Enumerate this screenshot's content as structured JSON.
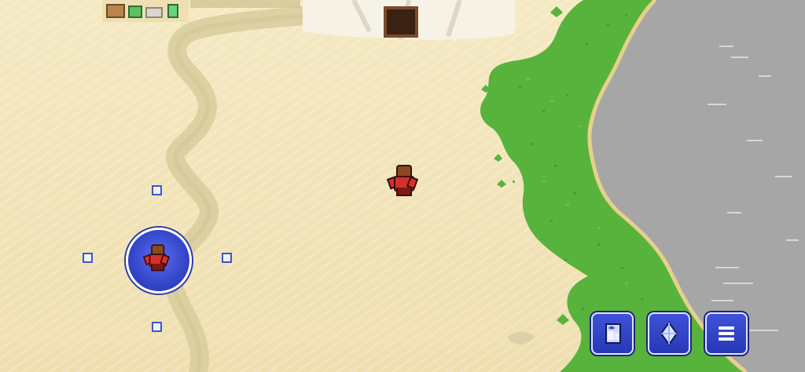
{
  "scene": {
    "type": "top-down RPG overworld",
    "terrain": [
      "sand",
      "grass",
      "sea"
    ],
    "colors": {
      "sand": "#f1e4b6",
      "grass": "#55b33a",
      "sea": "#a7a7a7",
      "ui_blue": "#2f43c8"
    }
  },
  "ui": {
    "joystick": {
      "icon": "character-icon"
    },
    "buttons": [
      {
        "name": "map-button",
        "icon": "map-icon"
      },
      {
        "name": "crystal-button",
        "icon": "crystal-icon"
      },
      {
        "name": "menu-button",
        "icon": "hamburger-menu-icon"
      }
    ]
  }
}
